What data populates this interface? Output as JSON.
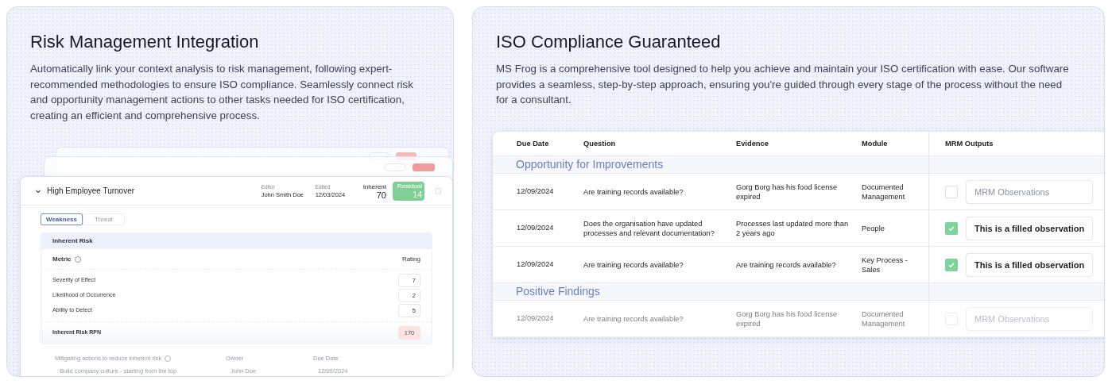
{
  "risk_panel": {
    "title": "Risk Management Integration",
    "description": "Automatically link your context analysis to risk management, following expert-recommended methodologies to ensure ISO compliance. Seamlessly connect risk and opportunity management actions to other tasks needed for ISO certification, creating an efficient and comprehensive process.",
    "risk_card": {
      "title": "High Employee Turnover",
      "expanded": true,
      "editor_label": "Editor",
      "editor": "John Smith Doe",
      "edited_label": "Edited",
      "edited": "12/03/2024",
      "inherent_label": "Inherent",
      "inherent": "70",
      "residual_label": "Residual",
      "residual": "14",
      "tabs": [
        {
          "label": "Weakness",
          "selected": true
        },
        {
          "label": "Threat",
          "selected": false
        }
      ],
      "section_title": "Inherent Risk",
      "metric_header": "Metric",
      "rating_header": "Rating",
      "metrics": [
        {
          "name": "Severity of Effect",
          "rating": "7"
        },
        {
          "name": "Likelihood of Occurrence",
          "rating": "2"
        },
        {
          "name": "Ability to Detect",
          "rating": "5"
        }
      ],
      "rpn_label": "Inherent Risk RPN",
      "rpn": "170",
      "mitigation": {
        "action_header": "Mitigating actions to reduce inherent risk",
        "owner_header": "Owner",
        "due_header": "Due Date",
        "action": "Build company culture - starting from the top",
        "owner": "John Doe",
        "due": "12/09/2024"
      }
    }
  },
  "iso_panel": {
    "title": "ISO Compliance Guaranteed",
    "description": "MS Frog is a comprehensive tool designed to help you achieve and maintain your ISO certification with ease. Our software provides a seamless, step-by-step approach, ensuring you're guided through every stage of the process without the need for a consultant.",
    "table": {
      "columns": [
        "Due Date",
        "Question",
        "Evidence",
        "Module",
        "MRM Outputs"
      ],
      "groups": [
        {
          "title": "Opportunity for Improvements",
          "rows": [
            {
              "due": "12/09/2024",
              "question": "Are training records available?",
              "evidence": "Gorg Borg has his food license expired",
              "module": "Documented Management",
              "checked": false,
              "placeholder": "MRM Observations",
              "faded": false
            },
            {
              "due": "12/09/2024",
              "question": "Does the organisation have updated processes and relevant documentation?",
              "evidence": "Processes last updated more than 2 years ago",
              "module": "People",
              "checked": true,
              "observation": "This is a filled observation",
              "faded": false
            },
            {
              "due": "12/09/2024",
              "question": "Are training records available?",
              "evidence": "Are training records available?",
              "module": "Key Process - Sales",
              "checked": true,
              "observation": "This is a filled observation",
              "faded": false
            }
          ]
        },
        {
          "title": "Positive Findings",
          "rows": [
            {
              "due": "12/09/2024",
              "question": "Are training records available?",
              "evidence": "Gorg Borg has his food license expired",
              "module": "Documented Management",
              "checked": false,
              "placeholder": "MRM Observations",
              "faded": true
            }
          ]
        }
      ]
    }
  }
}
